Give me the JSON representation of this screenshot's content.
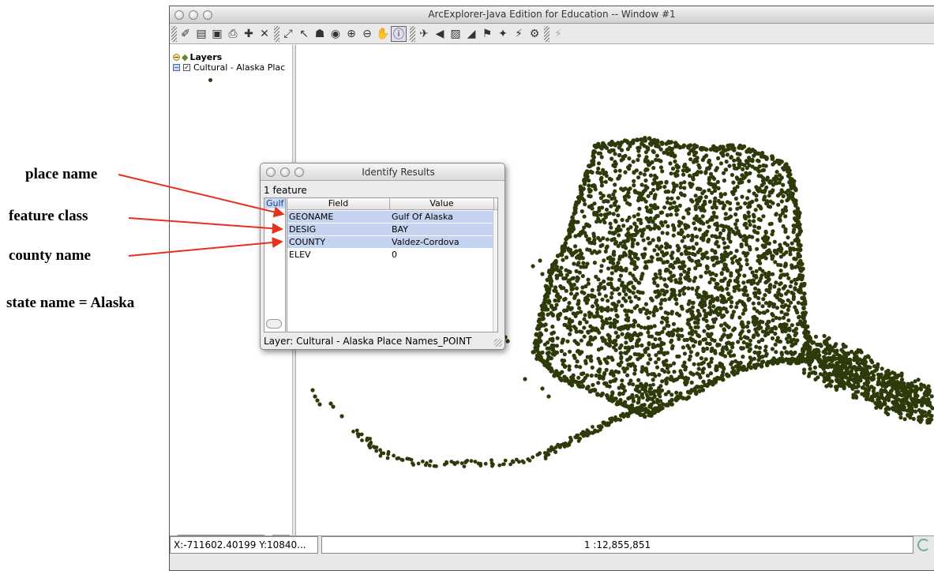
{
  "window": {
    "title": "ArcExplorer-Java Edition for Education -- Window #1"
  },
  "toolbar": {
    "icons": [
      "new-map-icon",
      "open-icon",
      "save-icon",
      "print-icon",
      "add-layer-icon",
      "remove-layer-icon",
      "zoom-to-full-icon",
      "zoom-to-active-icon",
      "zoom-previous-icon",
      "zoom-to-layer-icon",
      "zoom-in-icon",
      "zoom-out-icon",
      "pan-icon",
      "identify-icon",
      "find-icon",
      "query-builder-icon",
      "buffer-icon",
      "measure-icon",
      "select-features-icon",
      "clear-selection-icon",
      "hotlink-icon",
      "properties-icon",
      "disabled-tool-icon"
    ],
    "active_tool": "identify-icon"
  },
  "legend": {
    "header": "Layers",
    "layer_name": "Cultural - Alaska Plac",
    "layer_checked": true
  },
  "dialog": {
    "title": "Identify Results",
    "feature_count": "1 feature",
    "feature_item": "Gulf",
    "columns": [
      "Field",
      "Value"
    ],
    "rows": [
      {
        "field": "GEONAME",
        "value": "Gulf Of Alaska",
        "selected": true
      },
      {
        "field": "DESIG",
        "value": "BAY",
        "selected": true
      },
      {
        "field": "COUNTY",
        "value": "Valdez-Cordova",
        "selected": true
      },
      {
        "field": "ELEV",
        "value": "0",
        "selected": false
      }
    ],
    "layer_path": "Layer: Cultural - Alaska Place Names_POINT"
  },
  "statusbar": {
    "coordinates": "X:-711602.40199 Y:10840...",
    "scale": "1 :12,855,851"
  },
  "annotations": {
    "place_name": "place name",
    "feature_class": "feature class",
    "county_name": "county name",
    "state_name": "state name = Alaska"
  },
  "colors": {
    "map_points": "#2f3a0a",
    "arrow": "#e8301c",
    "selection": "#c4d4f0"
  }
}
